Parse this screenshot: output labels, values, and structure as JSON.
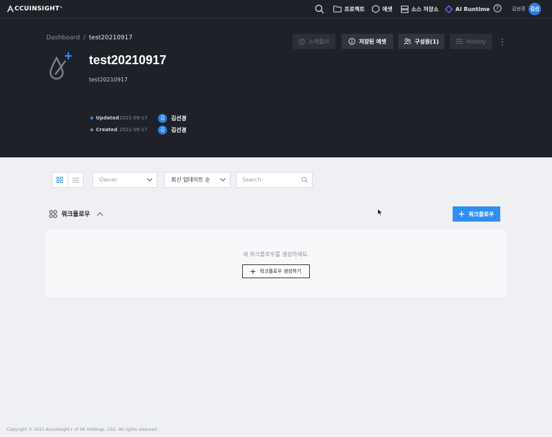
{
  "app": {
    "logo_text": "CCUINSIGHT",
    "logo_mark": "A",
    "logo_trademark": "+"
  },
  "nav": {
    "items": [
      {
        "label": "프로젝트",
        "icon": "folder-icon"
      },
      {
        "label": "에셋",
        "icon": "hexagon-icon"
      },
      {
        "label": "소스 저장소",
        "icon": "server-icon"
      },
      {
        "label": "AI Runtime",
        "icon": "ai-runtime-icon"
      }
    ],
    "user_name": "김선경",
    "user_initials": "김선"
  },
  "breadcrumb": {
    "root": "Dashboard",
    "separator": "/",
    "current": "test20210917"
  },
  "actions": {
    "scheduler": "스케줄러",
    "saved_assets": "저장된 에셋",
    "members": "구성원(1)",
    "history": "History"
  },
  "project": {
    "title": "test20210917",
    "description": "test20210917",
    "updated_label": "Updated",
    "updated_date": "2021-09-17",
    "updated_by": "김선경",
    "created_label": "Created",
    "created_date": "2021-09-17",
    "created_by": "김선경",
    "avatar_initial": "김"
  },
  "filters": {
    "owner_placeholder": "Owner",
    "sort_value": "최신 업데이트 순",
    "search_placeholder": "Search"
  },
  "workflow": {
    "section_title": "워크플로우",
    "add_button": "워크플로우",
    "empty_message": "새 워크플로우를 생성하세요.",
    "create_button": "워크플로우 생성하기"
  },
  "footer": {
    "copyright": "Copyright © 2021 AccuInsight+ of SK Holdings, C&C. All rights reserved."
  },
  "colors": {
    "header_bg": "#1f2128",
    "accent": "#2f8ff0",
    "avatar": "#2b7fe0",
    "page_bg": "#eef0f4"
  }
}
